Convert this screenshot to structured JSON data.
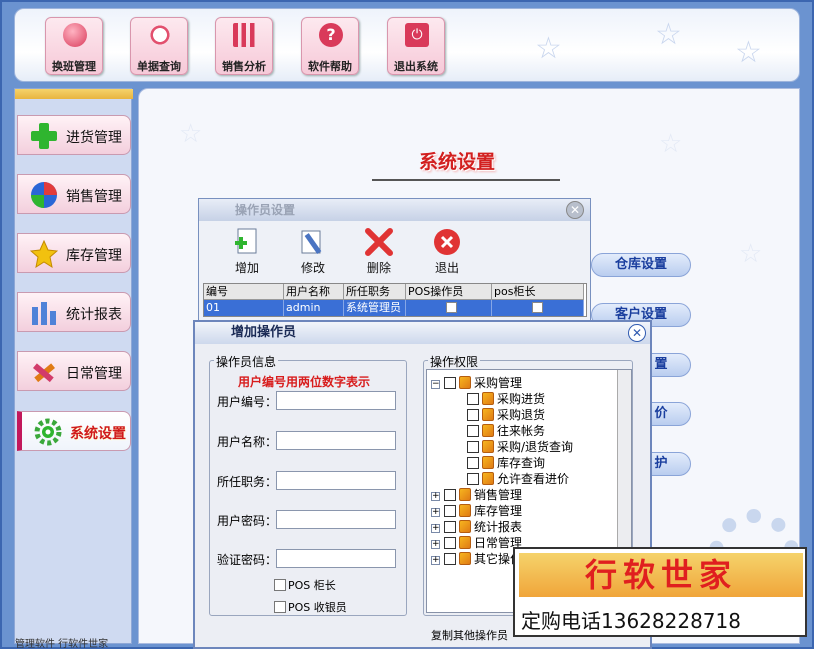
{
  "toolbar": {
    "buttons": [
      {
        "label": "换班管理",
        "icon": "users-icon"
      },
      {
        "label": "单据查询",
        "icon": "magnifier-icon"
      },
      {
        "label": "销售分析",
        "icon": "bar-chart-icon"
      },
      {
        "label": "软件帮助",
        "icon": "help-icon"
      },
      {
        "label": "退出系统",
        "icon": "power-icon"
      }
    ]
  },
  "sidebar": {
    "items": [
      {
        "label": "进货管理",
        "icon": "plus-icon"
      },
      {
        "label": "销售管理",
        "icon": "globe-icon"
      },
      {
        "label": "库存管理",
        "icon": "star-icon"
      },
      {
        "label": "统计报表",
        "icon": "bar-chart-icon"
      },
      {
        "label": "日常管理",
        "icon": "tools-icon"
      },
      {
        "label": "系统设置",
        "icon": "gear-icon",
        "active": true
      }
    ],
    "footer_note": "管理软件 行软件世家"
  },
  "main": {
    "title": "系统设置",
    "pills": [
      "仓库设置",
      "客户设置",
      "置",
      "价",
      "护"
    ]
  },
  "operator_window": {
    "title": "操作员设置",
    "tools": [
      {
        "label": "增加",
        "icon": "add-doc-icon"
      },
      {
        "label": "修改",
        "icon": "edit-doc-icon"
      },
      {
        "label": "删除",
        "icon": "delete-x-icon"
      },
      {
        "label": "退出",
        "icon": "exit-icon"
      }
    ],
    "columns": [
      "编号",
      "用户名称",
      "所任职务",
      "POS操作员",
      "pos柜长"
    ],
    "rows": [
      {
        "id": "01",
        "name": "admin",
        "role": "系统管理员",
        "pos_operator": false,
        "pos_chief": false
      }
    ]
  },
  "add_dialog": {
    "title": "增加操作员",
    "info_group": "操作员信息",
    "hint": "用户编号用两位数字表示",
    "fields": [
      {
        "label": "用户编号：",
        "value": ""
      },
      {
        "label": "用户名称：",
        "value": ""
      },
      {
        "label": "所任职务：",
        "value": ""
      },
      {
        "label": "用户密码：",
        "value": ""
      },
      {
        "label": "验证密码：",
        "value": ""
      }
    ],
    "checkboxes": [
      {
        "label": "POS 柜长",
        "checked": false
      },
      {
        "label": "POS 收银员",
        "checked": false
      }
    ],
    "perm_group": "操作权限",
    "tree": {
      "root": "采购管理",
      "root_children": [
        "采购进货",
        "采购退货",
        "往来帐务",
        "采购/退货查询",
        "库存查询",
        "允许查看进价"
      ],
      "siblings": [
        "销售管理",
        "库存管理",
        "统计报表",
        "日常管理",
        "其它操作"
      ]
    },
    "copy_link": "复制其他操作员"
  },
  "watermark": {
    "brand": "行软世家",
    "phone": "定购电话13628228718"
  }
}
